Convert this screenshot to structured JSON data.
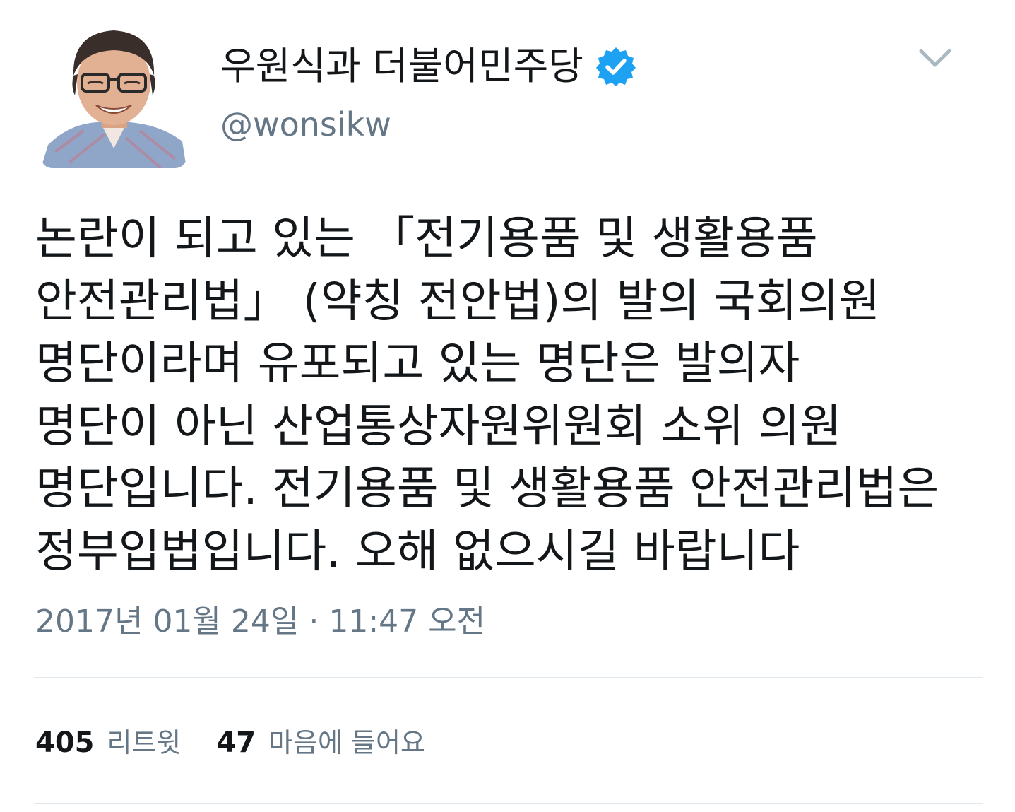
{
  "author": {
    "display_name": "우원식과 더불어민주당",
    "handle": "@wonsikw",
    "verified_icon": "verified-badge-icon",
    "avatar_icon": "profile-photo"
  },
  "tweet": {
    "lines": [
      "논란이 되고 있는 「전기용품 및 생활용품",
      "안전관리법」 (약칭 전안법)의 발의 국회의원",
      "명단이라며 유포되고 있는 명단은 발의자",
      "명단이 아닌 산업통상자원위원회 소위 의원",
      "명단입니다. 전기용품 및 생활용품 안전관리법은",
      "정부입법입니다. 오해 없으시길 바랍니다"
    ],
    "timestamp": "2017년 01월 24일 · 11:47 오전"
  },
  "stats": {
    "retweet_count": "405",
    "retweet_label": "리트윗",
    "like_count": "47",
    "like_label": "마음에 들어요"
  },
  "colors": {
    "verified_blue": "#1da1f2",
    "secondary_text": "#657786",
    "divider": "#e1e8ed",
    "primary_text": "#14171a"
  },
  "menu_icon": "chevron-down-icon"
}
